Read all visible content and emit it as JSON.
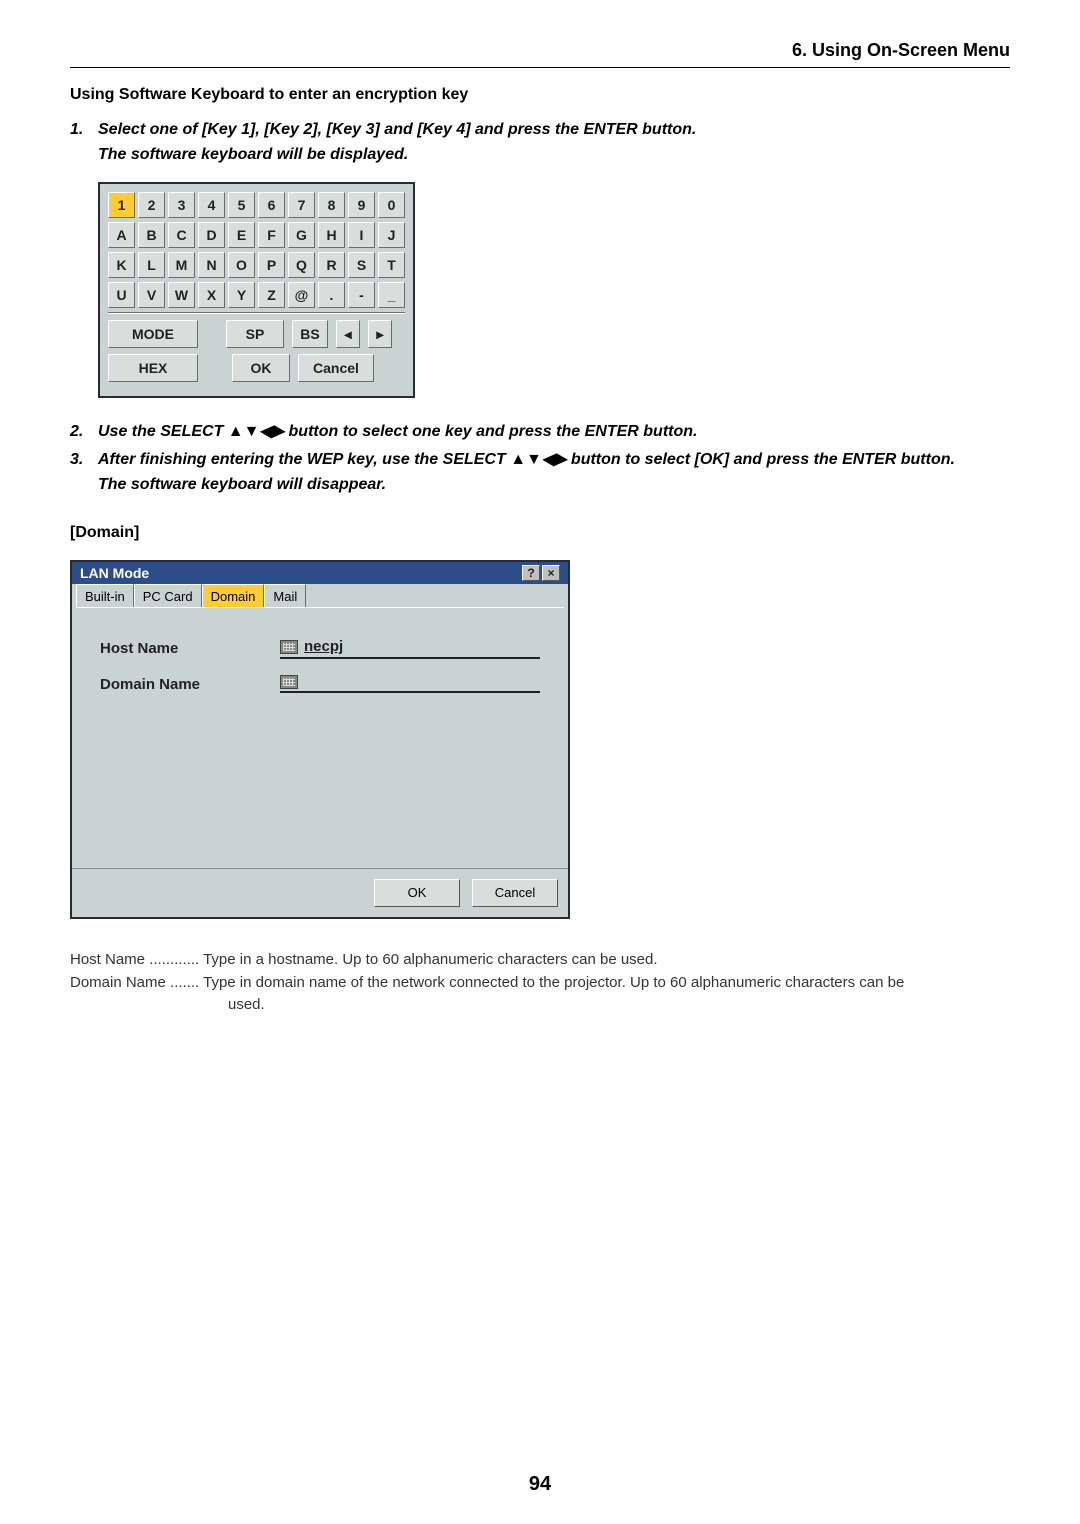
{
  "header": {
    "section_title": "6. Using On-Screen Menu"
  },
  "heading": "Using Software Keyboard to enter an encryption key",
  "step1": {
    "num": "1.",
    "text": "Select one of [Key 1], [Key 2], [Key 3] and [Key 4] and press the ENTER button.",
    "sub": "The software keyboard will be displayed."
  },
  "kb": {
    "row1": [
      "1",
      "2",
      "3",
      "4",
      "5",
      "6",
      "7",
      "8",
      "9",
      "0"
    ],
    "row2": [
      "A",
      "B",
      "C",
      "D",
      "E",
      "F",
      "G",
      "H",
      "I",
      "J"
    ],
    "row3": [
      "K",
      "L",
      "M",
      "N",
      "O",
      "P",
      "Q",
      "R",
      "S",
      "T"
    ],
    "row4": [
      "U",
      "V",
      "W",
      "X",
      "Y",
      "Z",
      "@",
      ".",
      "-",
      "_"
    ],
    "mode": "MODE",
    "sp": "SP",
    "bs": "BS",
    "left": "◂",
    "right": "▸",
    "hex": "HEX",
    "ok": "OK",
    "cancel": "Cancel"
  },
  "step2": {
    "num": "2.",
    "text": "Use the SELECT ▲▼◀▶  button to select one key and press the ENTER button."
  },
  "step3": {
    "num": "3.",
    "text": "After finishing entering the WEP key, use the SELECT ▲▼◀▶ button to select [OK] and press the ENTER button.",
    "sub": "The software keyboard will disappear."
  },
  "domain_heading": "[Domain]",
  "dialog": {
    "title": "LAN Mode",
    "help": "?",
    "close": "×",
    "tabs": [
      "Built-in",
      "PC Card",
      "Domain",
      "Mail"
    ],
    "active_tab": 2,
    "host_label": "Host Name",
    "host_value": "necpj",
    "domain_label": "Domain Name",
    "domain_value": "",
    "ok": "OK",
    "cancel": "Cancel"
  },
  "descriptions": {
    "host": "Host Name ............ Type in a hostname. Up to 60 alphanumeric characters can be used.",
    "domain1": "Domain Name ....... Type in domain name of the network connected to the projector. Up to 60 alphanumeric characters can be",
    "domain2": "used."
  },
  "page_number": "94"
}
